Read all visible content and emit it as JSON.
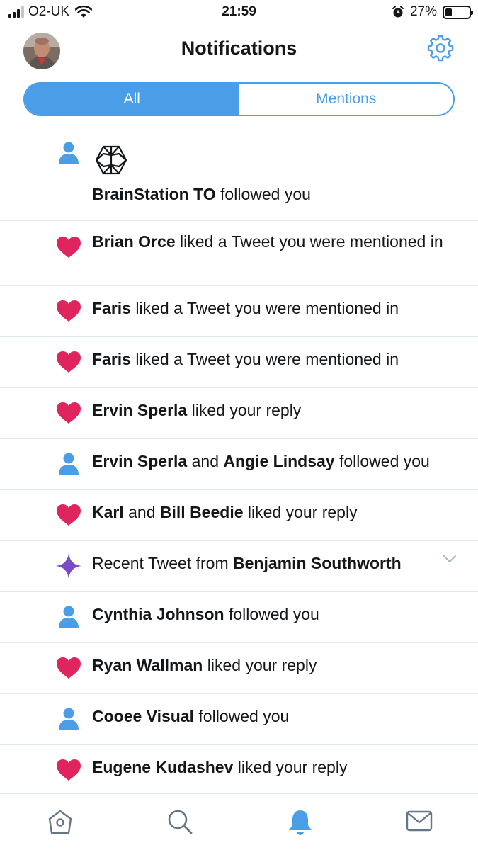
{
  "status_bar": {
    "carrier": "O2-UK",
    "time": "21:59",
    "battery_percent_label": "27%",
    "battery_level": 0.27
  },
  "header": {
    "title": "Notifications"
  },
  "tabs": [
    {
      "label": "All",
      "active": true
    },
    {
      "label": "Mentions",
      "active": false
    }
  ],
  "notifications": [
    {
      "type": "follow",
      "icon": "person-icon",
      "parts": [
        {
          "bold": "BrainStation TO"
        },
        {
          "text": " followed you"
        }
      ]
    },
    {
      "type": "like",
      "icon": "heart-icon",
      "parts": [
        {
          "bold": "Brian Orce"
        },
        {
          "text": " liked a Tweet you were mentioned in"
        }
      ]
    },
    {
      "type": "like",
      "icon": "heart-icon",
      "parts": [
        {
          "bold": "Faris"
        },
        {
          "text": " liked a Tweet you were mentioned in"
        }
      ]
    },
    {
      "type": "like",
      "icon": "heart-icon",
      "parts": [
        {
          "bold": "Faris"
        },
        {
          "text": " liked a Tweet you were mentioned in"
        }
      ]
    },
    {
      "type": "like",
      "icon": "heart-icon",
      "parts": [
        {
          "bold": "Ervin Sperla"
        },
        {
          "text": " liked your reply"
        }
      ]
    },
    {
      "type": "follow",
      "icon": "person-icon",
      "parts": [
        {
          "bold": "Ervin Sperla"
        },
        {
          "text": " and "
        },
        {
          "bold": "Angie Lindsay"
        },
        {
          "text": " followed you"
        }
      ]
    },
    {
      "type": "like",
      "icon": "heart-icon",
      "parts": [
        {
          "bold": "Karl"
        },
        {
          "text": " and "
        },
        {
          "bold": "Bill Beedie"
        },
        {
          "text": " liked your reply"
        }
      ]
    },
    {
      "type": "recent",
      "icon": "sparkle-icon",
      "parts": [
        {
          "text": "Recent Tweet from "
        },
        {
          "bold": "Benjamin Southworth"
        }
      ]
    },
    {
      "type": "follow",
      "icon": "person-icon",
      "parts": [
        {
          "bold": "Cynthia Johnson"
        },
        {
          "text": " followed you"
        }
      ]
    },
    {
      "type": "like",
      "icon": "heart-icon",
      "parts": [
        {
          "bold": "Ryan Wallman"
        },
        {
          "text": " liked your reply"
        }
      ]
    },
    {
      "type": "follow",
      "icon": "person-icon",
      "parts": [
        {
          "bold": "Cooee Visual"
        },
        {
          "text": " followed you"
        }
      ]
    },
    {
      "type": "like",
      "icon": "heart-icon",
      "parts": [
        {
          "bold": "Eugene Kudashev"
        },
        {
          "text": " liked your reply"
        }
      ]
    }
  ],
  "tab_bar": [
    {
      "name": "home-icon",
      "active": false
    },
    {
      "name": "search-icon",
      "active": false
    },
    {
      "name": "bell-icon",
      "active": true
    },
    {
      "name": "mail-icon",
      "active": false
    }
  ],
  "colors": {
    "accent": "#4a9ee8",
    "like": "#e0245e",
    "recent": "#794bc4",
    "divider": "#e1e8ed"
  }
}
